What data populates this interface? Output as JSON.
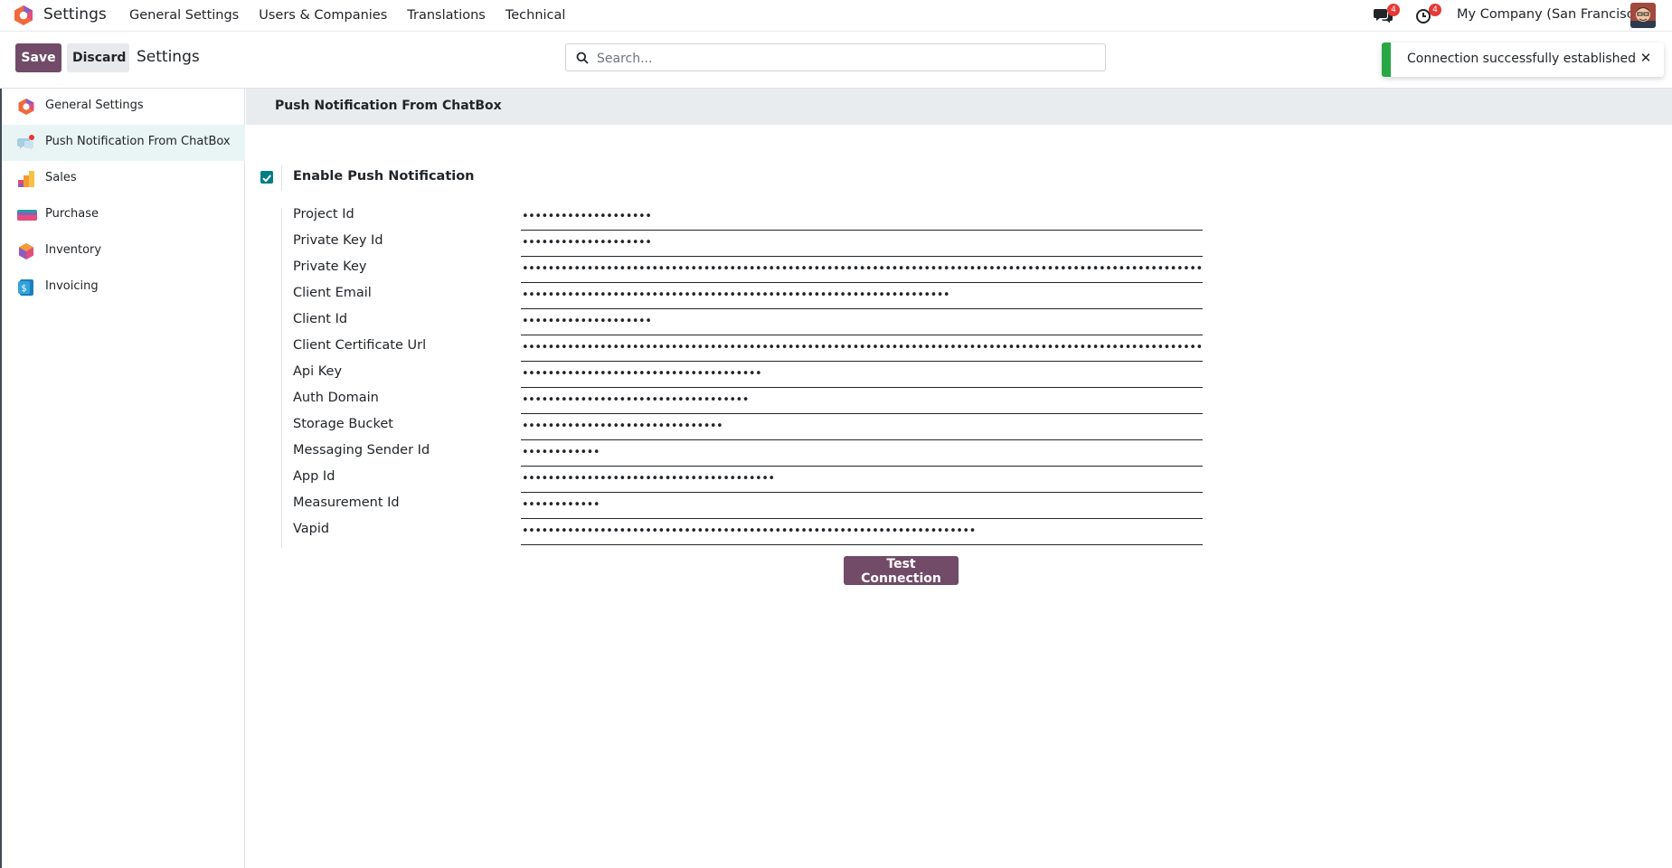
{
  "navbar": {
    "brand_title": "Settings",
    "menu": [
      "General Settings",
      "Users & Companies",
      "Translations",
      "Technical"
    ],
    "chat_badge": "4",
    "activity_badge": "4",
    "company": "My Company (San Francisco)"
  },
  "control_panel": {
    "save_label": "Save",
    "discard_label": "Discard",
    "breadcrumb": "Settings",
    "search_placeholder": "Search..."
  },
  "toast": {
    "message": "Connection successfully established",
    "close_glyph": "✕"
  },
  "sidebar": {
    "items": [
      {
        "label": "General Settings",
        "icon": "settings-app-icon"
      },
      {
        "label": "Push Notification From ChatBox",
        "icon": "chatbox-app-icon",
        "active": true
      },
      {
        "label": "Sales",
        "icon": "sales-app-icon"
      },
      {
        "label": "Purchase",
        "icon": "purchase-app-icon"
      },
      {
        "label": "Inventory",
        "icon": "inventory-app-icon"
      },
      {
        "label": "Invoicing",
        "icon": "invoicing-app-icon"
      }
    ]
  },
  "main": {
    "section_title": "Push Notification From ChatBox",
    "enable_label": "Enable Push Notification",
    "enable_checked": true,
    "fields": [
      {
        "label": "Project Id",
        "value": "••••••••••••••••••••"
      },
      {
        "label": "Private Key Id",
        "value": "••••••••••••••••••••"
      },
      {
        "label": "Private Key",
        "value": "••••••••••••••••••••••••••••••••••••••••••••••••••••••••••••••••••••••••••••••••••••••••••••••••••••••••••••••••••••••••••••••••••••••••••••••••••••••••"
      },
      {
        "label": "Client Email",
        "value": "••••••••••••••••••••••••••••••••••••••••••••••••••••••••••••••••••"
      },
      {
        "label": "Client Id",
        "value": "••••••••••••••••••••"
      },
      {
        "label": "Client Certificate Url",
        "value": "••••••••••••••••••••••••••••••••••••••••••••••••••••••••••••••••••••••••••••••••••••••••••••••••••••••••••••••••••••"
      },
      {
        "label": "Api Key",
        "value": "•••••••••••••••••••••••••••••••••••••"
      },
      {
        "label": "Auth Domain",
        "value": "•••••••••••••••••••••••••••••••••••"
      },
      {
        "label": "Storage Bucket",
        "value": "•••••••••••••••••••••••••••••••"
      },
      {
        "label": "Messaging Sender Id",
        "value": "••••••••••••"
      },
      {
        "label": "App Id",
        "value": "•••••••••••••••••••••••••••••••••••••••"
      },
      {
        "label": "Measurement Id",
        "value": "••••••••••••"
      },
      {
        "label": "Vapid",
        "value": "••••••••••••••••••••••••••••••••••••••••••••••••••••••••••••••••••••••"
      }
    ],
    "test_button_label": "Test Connection"
  },
  "colors": {
    "primary": "#714b67",
    "success": "#28a745",
    "checkbox": "#017e84",
    "badge": "#e53935"
  }
}
